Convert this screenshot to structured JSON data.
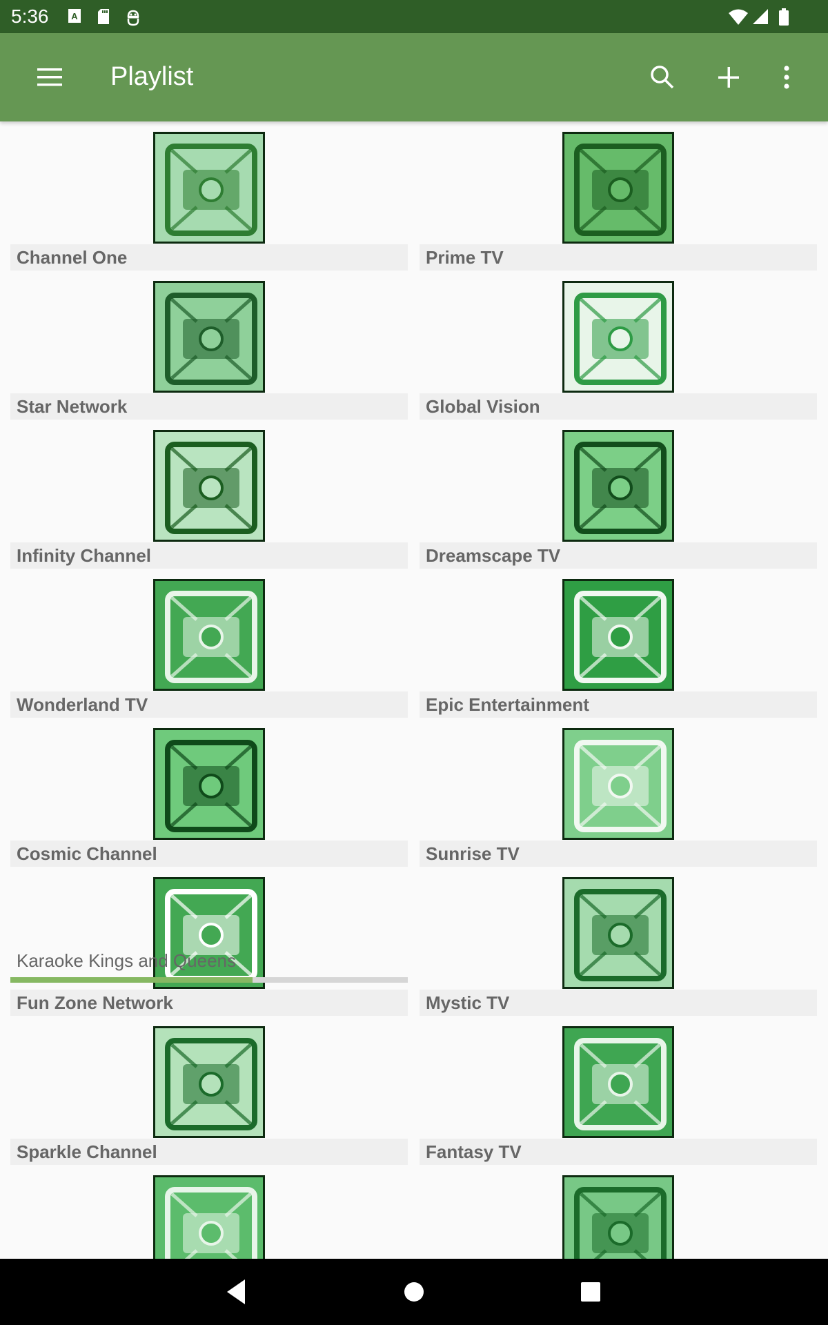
{
  "status_bar": {
    "time": "5:36",
    "icons": [
      "keyboard-a-icon",
      "sd-card-icon",
      "android-debug-icon",
      "wifi-icon",
      "cellular-signal-icon",
      "battery-icon"
    ]
  },
  "app_bar": {
    "title": "Playlist",
    "menu_icon": "hamburger-menu-icon",
    "actions": [
      "search-icon",
      "add-icon",
      "more-vert-icon"
    ]
  },
  "channels": [
    {
      "name": "Channel One",
      "thumb_colors": [
        "#a6dbb0",
        "#2e7d32"
      ]
    },
    {
      "name": "Prime TV",
      "thumb_colors": [
        "#66bb6a",
        "#1b5e20"
      ]
    },
    {
      "name": "Star Network",
      "thumb_colors": [
        "#8fd09a",
        "#1e5d2a"
      ]
    },
    {
      "name": "Global Vision",
      "thumb_colors": [
        "#e8f5e9",
        "#2e9b45"
      ]
    },
    {
      "name": "Infinity Channel",
      "thumb_colors": [
        "#b9e4c0",
        "#1b5e20"
      ]
    },
    {
      "name": "Dreamscape TV",
      "thumb_colors": [
        "#7ccf87",
        "#124d1c"
      ]
    },
    {
      "name": "Wonderland TV",
      "thumb_colors": [
        "#43a853",
        "#e8f5e9"
      ]
    },
    {
      "name": "Epic Entertainment",
      "thumb_colors": [
        "#2f9e44",
        "#f1f8f1"
      ]
    },
    {
      "name": "Cosmic Channel",
      "thumb_colors": [
        "#6fca7c",
        "#0f4a1a"
      ]
    },
    {
      "name": "Sunrise TV",
      "thumb_colors": [
        "#7fcf8c",
        "#f1f8f1"
      ]
    },
    {
      "name": "Fun Zone Network",
      "thumb_colors": [
        "#43a853",
        "#ffffff"
      ],
      "now_playing": "Karaoke Kings and Queens",
      "progress_percent": 61
    },
    {
      "name": "Mystic TV",
      "thumb_colors": [
        "#a5dbae",
        "#1b6b2a"
      ]
    },
    {
      "name": "Sparkle Channel",
      "thumb_colors": [
        "#b4e2ba",
        "#1b6b2a"
      ]
    },
    {
      "name": "Fantasy TV",
      "thumb_colors": [
        "#3fa652",
        "#e8f5e9"
      ]
    },
    {
      "name": "",
      "thumb_colors": [
        "#5cbc6c",
        "#e8f5e9"
      ]
    },
    {
      "name": "",
      "thumb_colors": [
        "#78c886",
        "#1b6b2a"
      ]
    }
  ],
  "nav_bar": {
    "buttons": [
      "back-icon",
      "home-icon",
      "recents-icon"
    ]
  },
  "colors": {
    "status_bar": "#2f5e27",
    "app_bar": "#659753",
    "progress_fill": "#86b862",
    "progress_track": "#d6d6d6",
    "label_bg": "#efefef",
    "label_text": "#666666"
  }
}
